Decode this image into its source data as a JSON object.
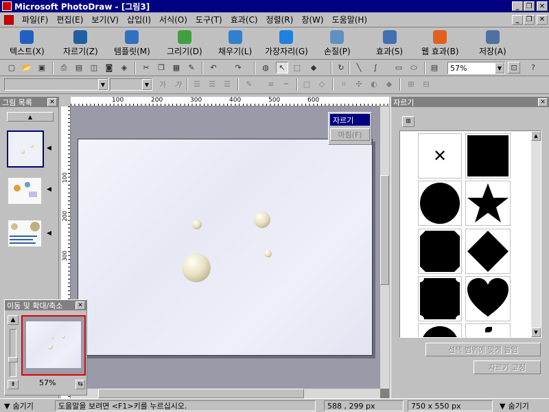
{
  "window": {
    "title": "Microsoft PhotoDraw - [그림3]"
  },
  "menu": [
    "파일(F)",
    "편집(E)",
    "보기(V)",
    "삽입(I)",
    "서식(O)",
    "도구(T)",
    "효과(C)",
    "정렬(R)",
    "창(W)",
    "도움말(H)"
  ],
  "big_toolbar": [
    {
      "label": "텍스트(X)",
      "icon": "text-icon",
      "color": "#2060c0"
    },
    {
      "label": "자르기(Z)",
      "icon": "scissors-icon",
      "color": "#2060a0"
    },
    {
      "label": "템플릿(M)",
      "icon": "template-icon",
      "color": "#3070c0"
    },
    {
      "label": "그리기(D)",
      "icon": "pencil-icon",
      "color": "#40a040"
    },
    {
      "label": "채우기(L)",
      "icon": "fill-icon",
      "color": "#3080d0"
    },
    {
      "label": "가장자리(G)",
      "icon": "edge-icon",
      "color": "#2080e0"
    },
    {
      "label": "손질(P)",
      "icon": "touchup-icon",
      "color": "#6090c0"
    },
    {
      "label": "효과(S)",
      "icon": "effects-icon",
      "color": "#4070b0"
    },
    {
      "label": "웹 효과(B)",
      "icon": "web-effects-icon",
      "color": "#e06020"
    },
    {
      "label": "저장(A)",
      "icon": "save-icon",
      "color": "#5070a0"
    }
  ],
  "toolbar": {
    "zoom": "57%"
  },
  "left_panel": {
    "title": "그림 목록"
  },
  "nav_panel": {
    "title": "이동 및 확대/축소",
    "zoom": "57%"
  },
  "popup": {
    "item1": "자르기",
    "item2": "마침(F)"
  },
  "ruler": {
    "labels": [
      "100",
      "200",
      "300",
      "400",
      "500",
      "600"
    ],
    "vlabels": [
      "100",
      "200",
      "300"
    ]
  },
  "right_panel": {
    "title": "자르기",
    "fit_button": "선택 범위에 맞게 늘임",
    "fix_button": "자르기 고정"
  },
  "status": {
    "hide_left": "숨기기",
    "help": "도움말을 보려면 <F1>키를 누르십시오.",
    "coords": "588 , 299  px",
    "size": "750 x 550  px",
    "hide_right": "숨기기"
  }
}
